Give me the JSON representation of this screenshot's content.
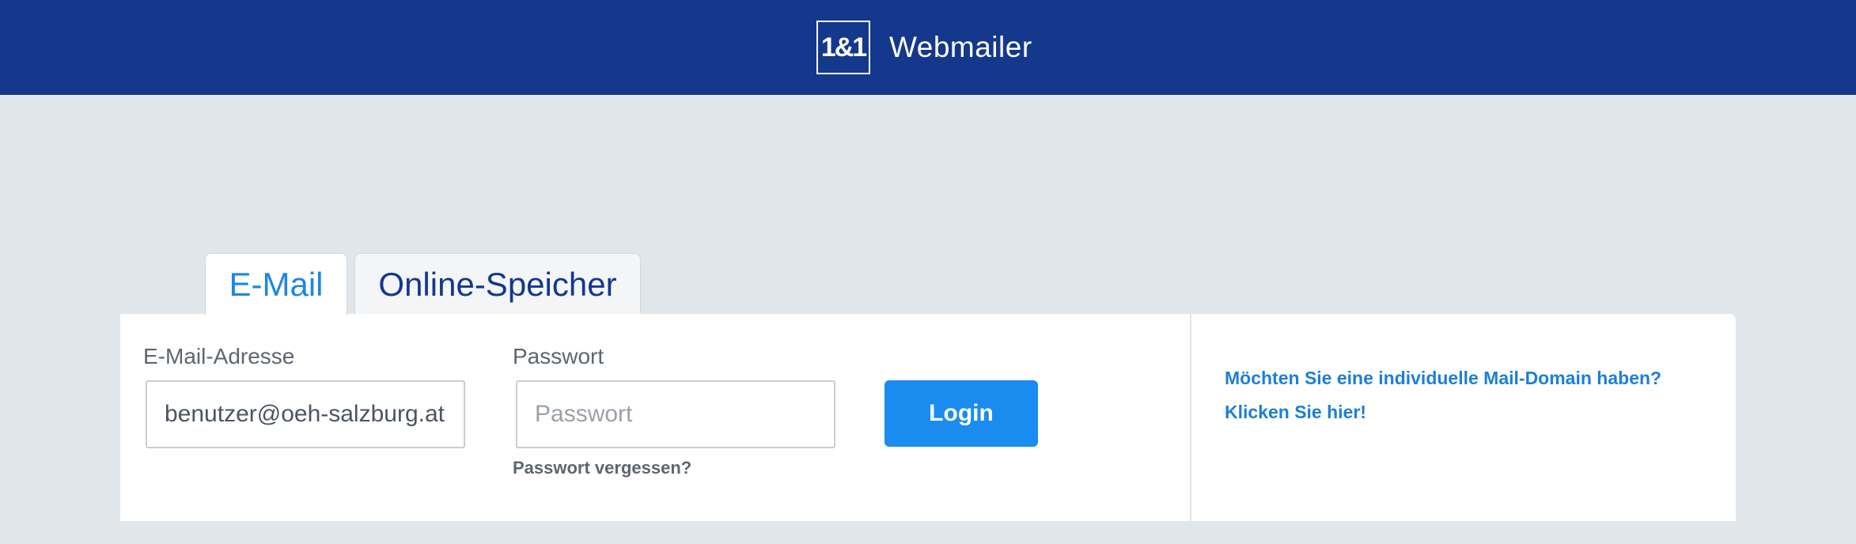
{
  "header": {
    "logo_text": "1&1",
    "app_name": "Webmailer"
  },
  "tabs": [
    {
      "label": "E-Mail",
      "active": true
    },
    {
      "label": "Online-Speicher",
      "active": false
    }
  ],
  "login": {
    "email_label": "E-Mail-Adresse",
    "email_value": "benutzer@oeh-salzburg.at",
    "password_label": "Passwort",
    "password_placeholder": "Passwort",
    "forgot_link": "Passwort vergessen?",
    "login_button": "Login"
  },
  "promo": {
    "line1": "Möchten Sie eine individuelle Mail-Domain haben?",
    "line2": "Klicken Sie hier!"
  },
  "colors": {
    "header_bg": "#14388b",
    "page_bg": "#e1e6ea",
    "accent": "#1a8cf0",
    "link": "#1c7fd6"
  }
}
